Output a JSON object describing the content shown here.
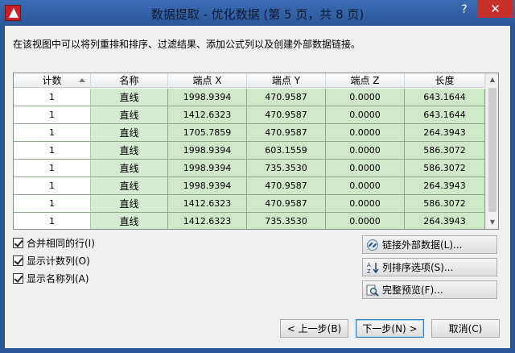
{
  "window": {
    "title": "数据提取 - 优化数据 (第 5 页，共 8 页)",
    "help_label": "?",
    "close_label": "✕"
  },
  "description": "在该视图中可以将列重排和排序、过滤结果、添加公式列以及创建外部数据链接。",
  "table": {
    "columns": [
      "计数",
      "名称",
      "端点 X",
      "端点 Y",
      "端点 Z",
      "长度"
    ],
    "rows": [
      [
        "1",
        "直线",
        "1998.9394",
        "470.9587",
        "0.0000",
        "643.1644"
      ],
      [
        "1",
        "直线",
        "1412.6323",
        "470.9587",
        "0.0000",
        "643.1644"
      ],
      [
        "1",
        "直线",
        "1705.7859",
        "470.9587",
        "0.0000",
        "264.3943"
      ],
      [
        "1",
        "直线",
        "1998.9394",
        "603.1559",
        "0.0000",
        "586.3072"
      ],
      [
        "1",
        "直线",
        "1998.9394",
        "735.3530",
        "0.0000",
        "586.3072"
      ],
      [
        "1",
        "直线",
        "1998.9394",
        "470.9587",
        "0.0000",
        "264.3943"
      ],
      [
        "1",
        "直线",
        "1412.6323",
        "470.9587",
        "0.0000",
        "586.3072"
      ],
      [
        "1",
        "直线",
        "1412.6323",
        "735.3530",
        "0.0000",
        "264.3943"
      ]
    ]
  },
  "options": [
    {
      "label": "合并相同的行(I)",
      "checked": true
    },
    {
      "label": "显示计数列(O)",
      "checked": true
    },
    {
      "label": "显示名称列(A)",
      "checked": true
    }
  ],
  "side_buttons": {
    "link": "链接外部数据(L)...",
    "sort": "列排序选项(S)...",
    "preview": "完整预览(F)..."
  },
  "footer": {
    "back": "< 上一步(B)",
    "next": "下一步(N) >",
    "cancel": "取消(C)"
  },
  "icons": {
    "link": "link-chain-icon",
    "sort": "sort-az-icon",
    "preview": "magnifier-preview-icon"
  },
  "colors": {
    "cell_green": "#cfe8c8",
    "title_bar": "#2b5797",
    "close_red": "#c7302a"
  }
}
